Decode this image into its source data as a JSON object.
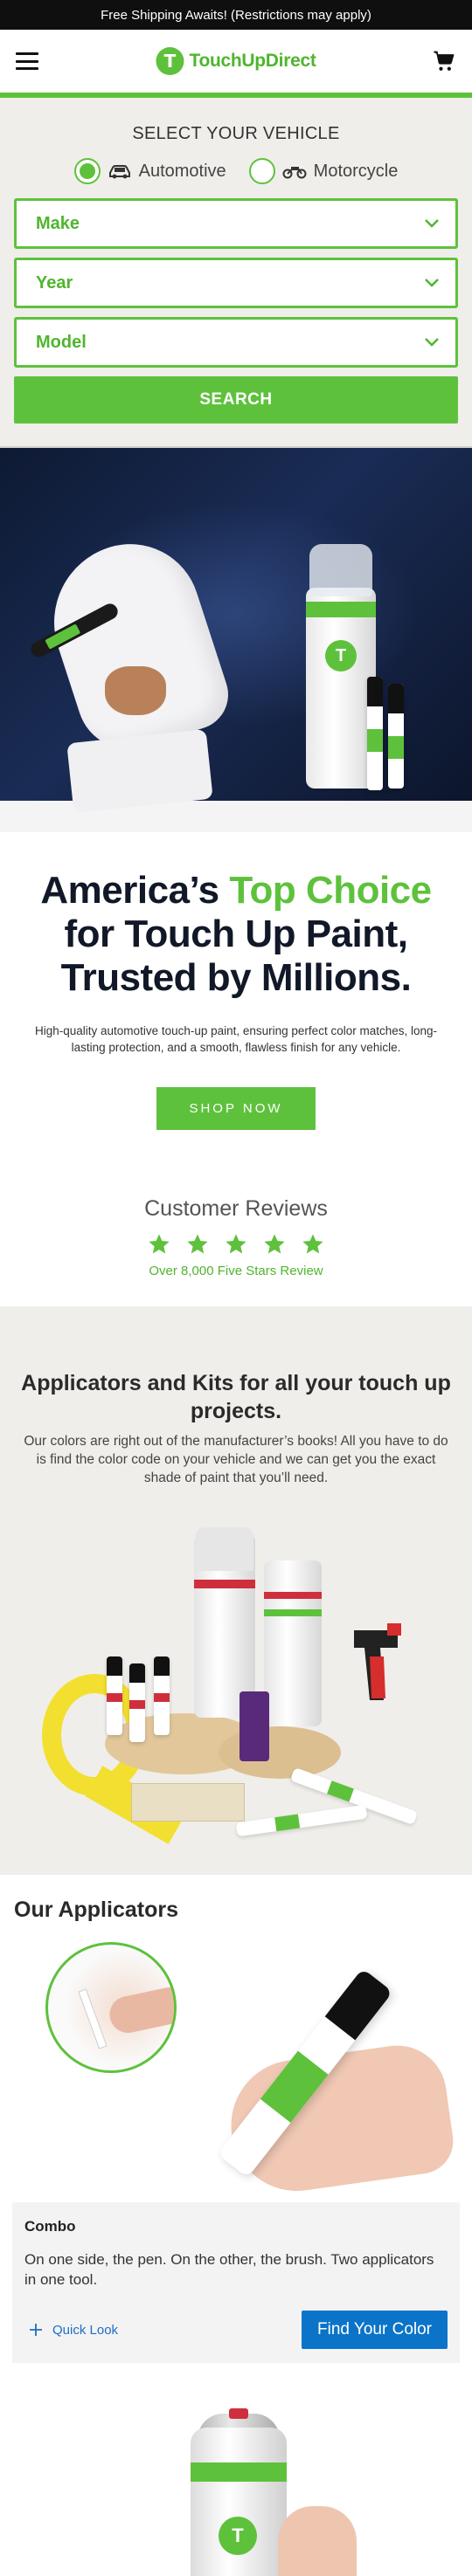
{
  "announcement": "Free Shipping Awaits! (Restrictions may apply)",
  "header": {
    "logo_mark": "T",
    "logo_text": "TouchUpDirect",
    "menu_icon": "hamburger-icon",
    "cart_icon": "cart-icon"
  },
  "selector": {
    "title": "SELECT YOUR VEHICLE",
    "options": [
      {
        "label": "Automotive",
        "selected": true,
        "icon": "car-icon"
      },
      {
        "label": "Motorcycle",
        "selected": false,
        "icon": "motorcycle-icon"
      }
    ],
    "make": "Make",
    "year": "Year",
    "model": "Model",
    "search": "SEARCH"
  },
  "hero": {
    "headline_part1": "America’s ",
    "headline_accent": "Top Choice",
    "headline_part2": "for Touch Up Paint, Trusted by Millions.",
    "description": "High-quality automotive touch-up paint, ensuring perfect color matches, long-lasting protection, and a smooth, flawless finish for any vehicle.",
    "cta": "SHOP NOW"
  },
  "reviews": {
    "title": "Customer Reviews",
    "rating": 5,
    "count_text": "Over 8,000 Five Stars Review"
  },
  "kits": {
    "title": "Applicators and Kits for all your touch up projects.",
    "description": "Our colors are right out of the manufacturer’s books! All you have to do is find the color code on your vehicle and we can get you the exact shade of paint that you’ll need."
  },
  "applicators": {
    "title": "Our Applicators",
    "card": {
      "title": "Combo",
      "description": "On one side, the pen. On the other, the brush. Two applicators in one tool.",
      "quick_look": "Quick Look",
      "find_color": "Find Your Color"
    }
  },
  "colors": {
    "brand_green": "#5ec13c",
    "find_button_blue": "#0b74c8",
    "section_beige": "#f0eeea"
  }
}
